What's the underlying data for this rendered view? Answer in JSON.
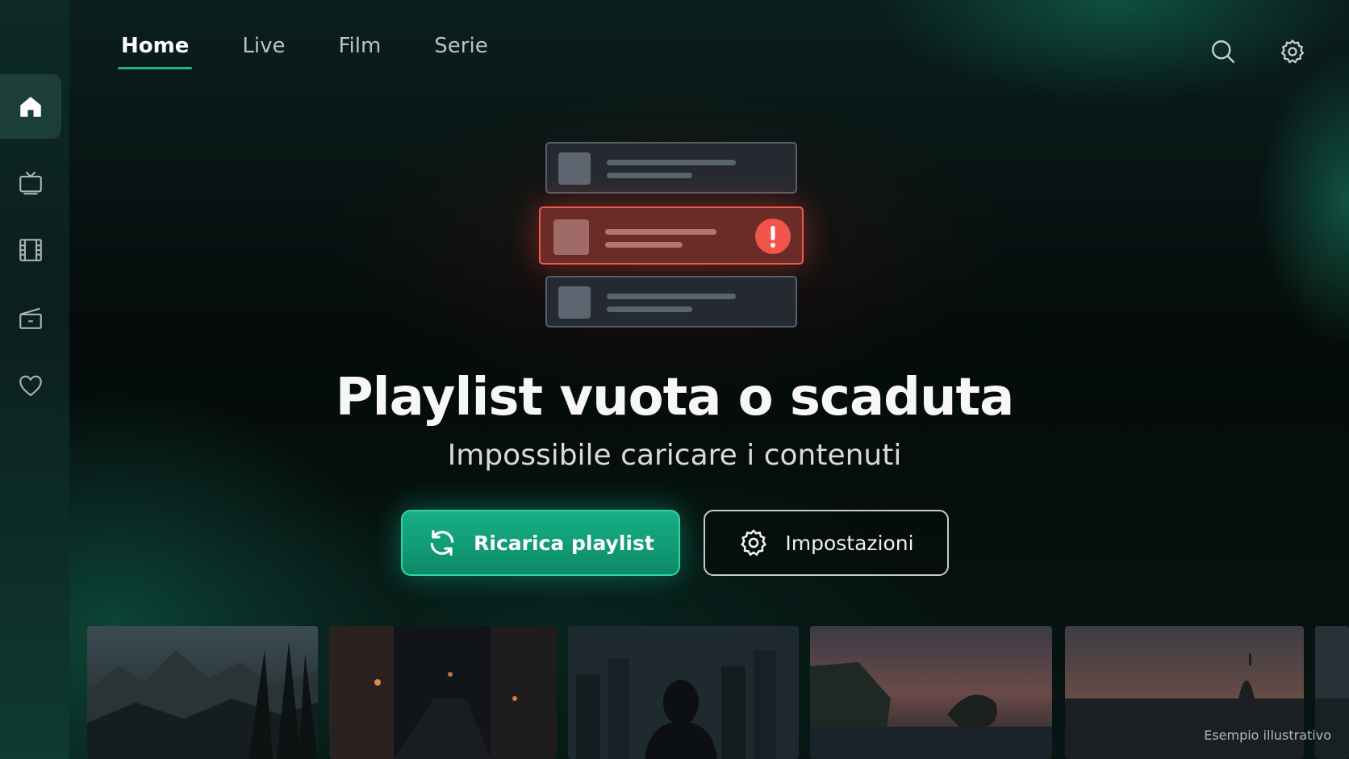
{
  "nav": {
    "tabs": [
      {
        "label": "Home",
        "active": true
      },
      {
        "label": "Live",
        "active": false
      },
      {
        "label": "Film",
        "active": false
      },
      {
        "label": "Serie",
        "active": false
      }
    ]
  },
  "sidebar": {
    "items": [
      {
        "icon": "home-icon",
        "active": true
      },
      {
        "icon": "tv-icon",
        "active": false
      },
      {
        "icon": "film-icon",
        "active": false
      },
      {
        "icon": "series-icon",
        "active": false
      },
      {
        "icon": "heart-icon",
        "active": false
      }
    ]
  },
  "top_icons": [
    "search-icon",
    "gear-icon"
  ],
  "error": {
    "title": "Playlist vuota o scaduta",
    "subtitle": "Impossibile caricare i contenuti"
  },
  "buttons": {
    "reload_label": "Ricarica playlist",
    "settings_label": "Impostazioni"
  },
  "caption": "Esempio illustrativo",
  "colors": {
    "accent": "#1db58b",
    "error": "#f0544a",
    "background": "#05100f"
  }
}
